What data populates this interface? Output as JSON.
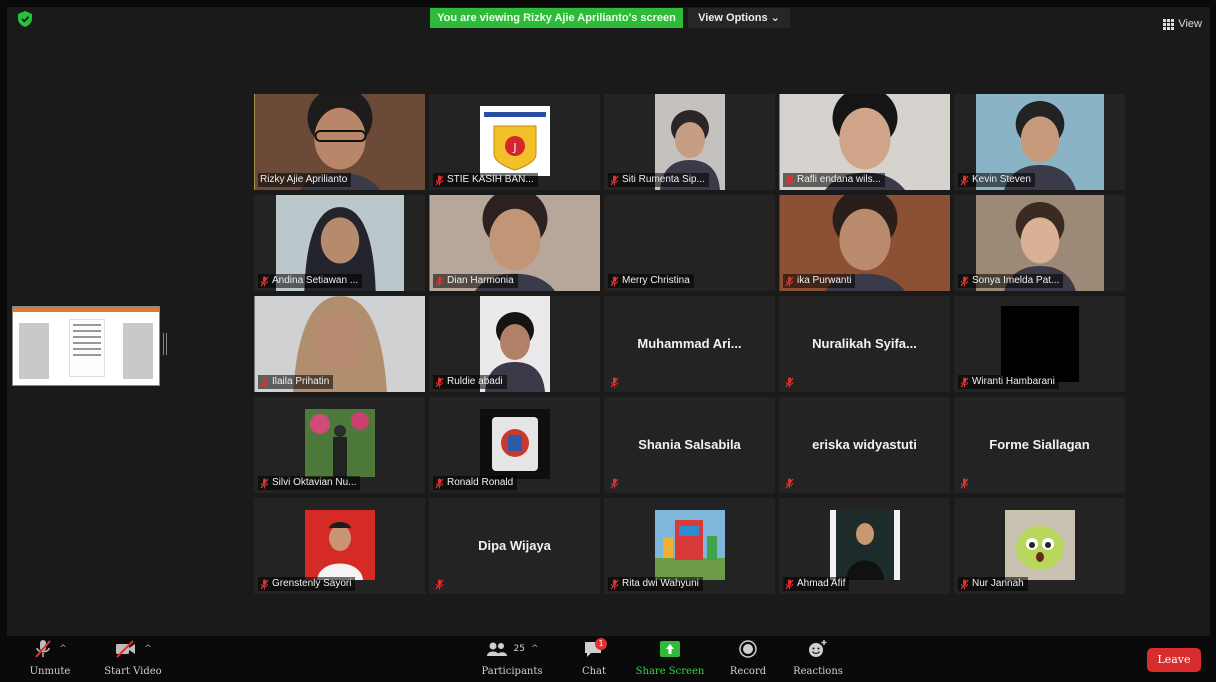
{
  "banner": "You are viewing Rizky Ajie Aprilianto's screen",
  "view_options": "View Options",
  "view": "View",
  "participants_grid": [
    {
      "name": "Rizky Ajie Aprilianto",
      "muted": false,
      "video": "person",
      "speaking": true
    },
    {
      "name": "STIE KASIH BAN...",
      "muted": true,
      "video": "logo"
    },
    {
      "name": "Siti Rumenta Sip...",
      "muted": true,
      "video": "person"
    },
    {
      "name": "Rafli endana wils...",
      "muted": true,
      "video": "person"
    },
    {
      "name": "Kevin Steven",
      "muted": true,
      "video": "person"
    },
    {
      "name": "Andina Setiawan ...",
      "muted": true,
      "video": "person"
    },
    {
      "name": "Dian Harmonia",
      "muted": true,
      "video": "person"
    },
    {
      "name": "Merry Christina",
      "muted": true,
      "video": "none"
    },
    {
      "name": "ika Purwanti",
      "muted": true,
      "video": "person"
    },
    {
      "name": "Sonya Imelda Pat...",
      "muted": true,
      "video": "person"
    },
    {
      "name": "Ilaila Prihatin",
      "muted": true,
      "video": "person"
    },
    {
      "name": "Ruldie abadi",
      "muted": true,
      "video": "person"
    },
    {
      "name": "",
      "big_name": "Muhammad Ari...",
      "muted": true,
      "video": "none"
    },
    {
      "name": "",
      "big_name": "Nuralikah Syifa...",
      "muted": true,
      "video": "none"
    },
    {
      "name": "Wiranti Hambarani",
      "muted": true,
      "video": "black"
    },
    {
      "name": "Silvi Oktavian Nu...",
      "muted": true,
      "video": "garden"
    },
    {
      "name": "Ronald Ronald",
      "muted": true,
      "video": "badge"
    },
    {
      "name": "",
      "big_name": "Shania Salsabila",
      "muted": true,
      "video": "none"
    },
    {
      "name": "",
      "big_name": "eriska widyastuti",
      "muted": true,
      "video": "none"
    },
    {
      "name": "",
      "big_name": "Forme Siallagan",
      "muted": true,
      "video": "none"
    },
    {
      "name": "Grenstenly Sayori",
      "muted": true,
      "video": "portrait"
    },
    {
      "name": "",
      "big_name": "Dipa Wijaya",
      "muted": true,
      "video": "none"
    },
    {
      "name": "Rita dwi Wahyuni",
      "muted": true,
      "video": "playground"
    },
    {
      "name": "Ahmad Afif",
      "muted": true,
      "video": "suit"
    },
    {
      "name": "Nur Jannah",
      "muted": true,
      "video": "cartoon"
    }
  ],
  "toolbar": {
    "unmute": "Unmute",
    "start_video": "Start Video",
    "participants": "Participants",
    "participants_count": "25",
    "chat": "Chat",
    "chat_badge": "1",
    "share_screen": "Share Screen",
    "record": "Record",
    "reactions": "Reactions",
    "leave": "Leave"
  },
  "colors": {
    "banner_green": "#2fbb3a",
    "speaking_outline": "#d7d754",
    "leave_red": "#d92c2c",
    "mute_red": "#e03131",
    "share_green": "#2fbb3a"
  }
}
